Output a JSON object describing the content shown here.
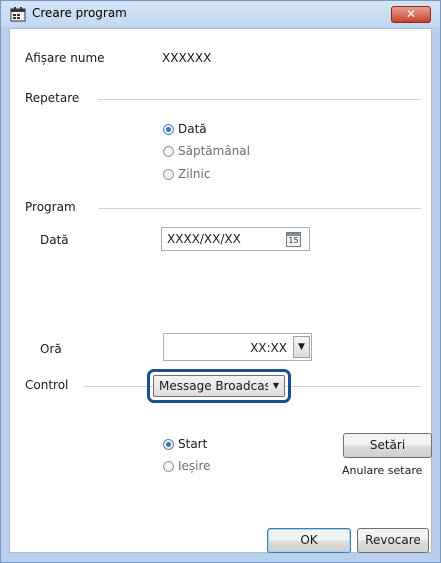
{
  "window": {
    "title": "Creare program",
    "close_label": "✕"
  },
  "display_name": {
    "label": "Afișare nume",
    "value": "XXXXXX"
  },
  "repeat": {
    "group_label": "Repetare",
    "options": [
      {
        "label": "Dată",
        "checked": true
      },
      {
        "label": "Săptămânal",
        "checked": false
      },
      {
        "label": "Zilnic",
        "checked": false
      }
    ]
  },
  "program": {
    "group_label": "Program",
    "date_label": "Dată",
    "date_value": "XXXX/XX/XX",
    "calendar_day": "15",
    "time_label": "Oră",
    "time_value": "XX:XX"
  },
  "control": {
    "group_label": "Control",
    "selected_option": "Message Broadcasting",
    "options": [
      {
        "label": "Start",
        "checked": true
      },
      {
        "label": "Ieșire",
        "checked": false
      }
    ],
    "settings_button": "Setări",
    "cancel_settings_text": "Anulare setare"
  },
  "footer": {
    "ok_label": "OK",
    "cancel_label": "Revocare"
  }
}
